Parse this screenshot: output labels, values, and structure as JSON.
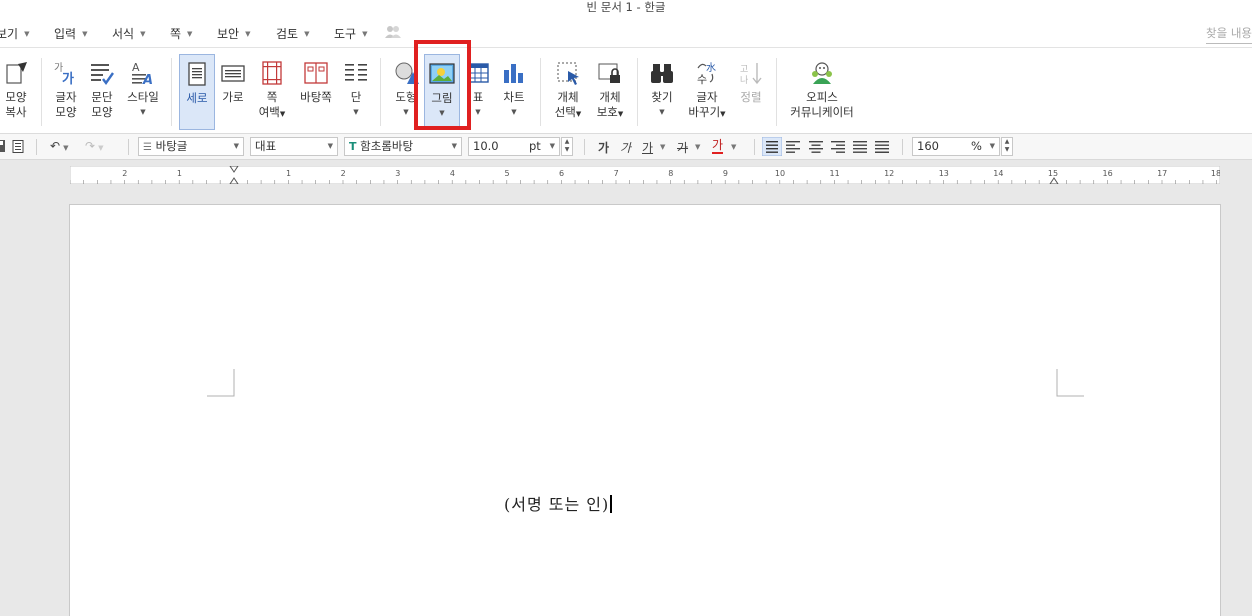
{
  "window": {
    "title": "빈 문서 1 - 한글"
  },
  "menu": {
    "items": [
      "보기",
      "입력",
      "서식",
      "쪽",
      "보안",
      "검토",
      "도구"
    ],
    "search_placeholder": "찾을 내용"
  },
  "ribbon": {
    "shape_copy": [
      "모양",
      "복사"
    ],
    "char_shape": [
      "글자",
      "모양"
    ],
    "para_shape": [
      "문단",
      "모양"
    ],
    "style": "스타일",
    "vertical": "세로",
    "horizontal": "가로",
    "page_margin": [
      "쪽",
      "여백"
    ],
    "master_page": "바탕쪽",
    "columns": "단",
    "shape": "도형",
    "picture": "그림",
    "table": "표",
    "chart": "차트",
    "object_select": [
      "개체",
      "선택"
    ],
    "object_protect": [
      "개체",
      "보호"
    ],
    "find": "찾기",
    "replace": [
      "글자",
      "바꾸기"
    ],
    "sort": "정렬",
    "office_communicator": [
      "오피스",
      "커뮤니케이터"
    ]
  },
  "format": {
    "style_value": "바탕글",
    "lang_value": "대표",
    "font_value": "함초롬바탕",
    "size_value": "10.0",
    "size_unit": "pt",
    "bold": "가",
    "italic": "가",
    "underline": "가",
    "strike": "가",
    "color": "가",
    "zoom_value": "160",
    "zoom_unit": "%"
  },
  "ruler": {
    "labels": [
      "2",
      "1",
      "1",
      "2",
      "3",
      "4",
      "5",
      "6",
      "7",
      "8",
      "9",
      "10",
      "11",
      "12",
      "13",
      "14",
      "15",
      "16",
      "17",
      "18"
    ]
  },
  "document": {
    "text": "(서명 또는 인)"
  },
  "colors": {
    "highlight": "#e02020",
    "selected_bg": "#dbe7f8",
    "accent_blue": "#3a6fc4"
  }
}
